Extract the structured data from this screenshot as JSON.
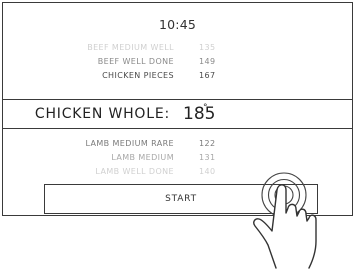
{
  "screen": {
    "clock": "10:45",
    "upper_items": [
      {
        "name": "BEEF MEDIUM WELL",
        "temp": "135"
      },
      {
        "name": "BEEF WELL DONE",
        "temp": "149"
      },
      {
        "name": "CHICKEN PIECES",
        "temp": "167"
      }
    ],
    "selected": {
      "name": "CHICKEN WHOLE:",
      "temp": "185",
      "unit": "°"
    },
    "lower_items": [
      {
        "name": "LAMB MEDIUM RARE",
        "temp": "122"
      },
      {
        "name": "LAMB MEDIUM",
        "temp": "131"
      },
      {
        "name": "LAMB WELL DONE",
        "temp": "140"
      }
    ],
    "start_label": "START"
  },
  "colors": {
    "faint": "#c9c9c9",
    "mid": "#8a8a8a",
    "dark": "#4a4a4a",
    "line": "#3a3a3a"
  },
  "icons": {
    "gesture": "tapping-hand-icon"
  }
}
